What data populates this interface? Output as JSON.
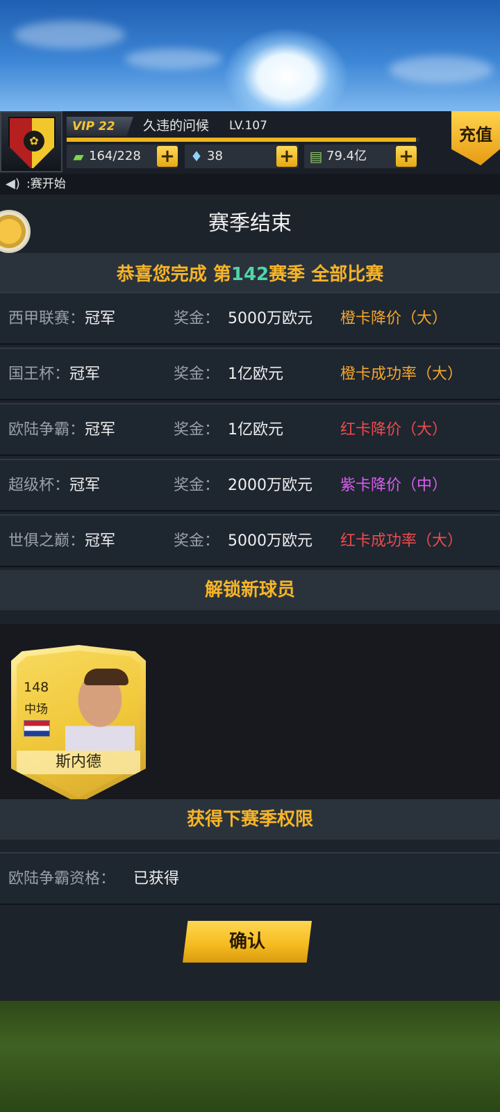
{
  "header": {
    "vip_label": "VIP 22",
    "username": "久违的问候",
    "level": "LV.107",
    "xp_progress": 0.99,
    "energy": "164/228",
    "diamonds": "38",
    "money": "79.4亿",
    "plus_label": "+",
    "recharge_label": "充值"
  },
  "notice": {
    "text": ":赛开始"
  },
  "panel": {
    "title": "赛季结束",
    "congrats_prefix": "恭喜您完成 第",
    "season_number": "142",
    "congrats_suffix": "赛季 全部比赛",
    "prize_label": "奖金：",
    "results": [
      {
        "league": "西甲联赛：",
        "result": "冠军",
        "prize": "5000万欧元",
        "reward": "橙卡降价（大）",
        "reward_color": "#f5a62a"
      },
      {
        "league": "国王杯：",
        "result": "冠军",
        "prize": "1亿欧元",
        "reward": "橙卡成功率（大）",
        "reward_color": "#f5a62a"
      },
      {
        "league": "欧陆争霸：",
        "result": "冠军",
        "prize": "1亿欧元",
        "reward": "红卡降价（大）",
        "reward_color": "#ef4b4b"
      },
      {
        "league": "超级杯：",
        "result": "冠军",
        "prize": "2000万欧元",
        "reward": "紫卡降价（中）",
        "reward_color": "#d95ef0"
      },
      {
        "league": "世俱之巅：",
        "result": "冠军",
        "prize": "5000万欧元",
        "reward": "红卡成功率（大）",
        "reward_color": "#ef4b4b"
      }
    ],
    "unlock_heading": "解锁新球员",
    "player": {
      "rating": "148",
      "position": "中场",
      "name": "斯内德"
    },
    "permission_heading": "获得下赛季权限",
    "permission_label": "欧陆争霸资格：",
    "permission_value": "已获得",
    "confirm_label": "确认"
  }
}
